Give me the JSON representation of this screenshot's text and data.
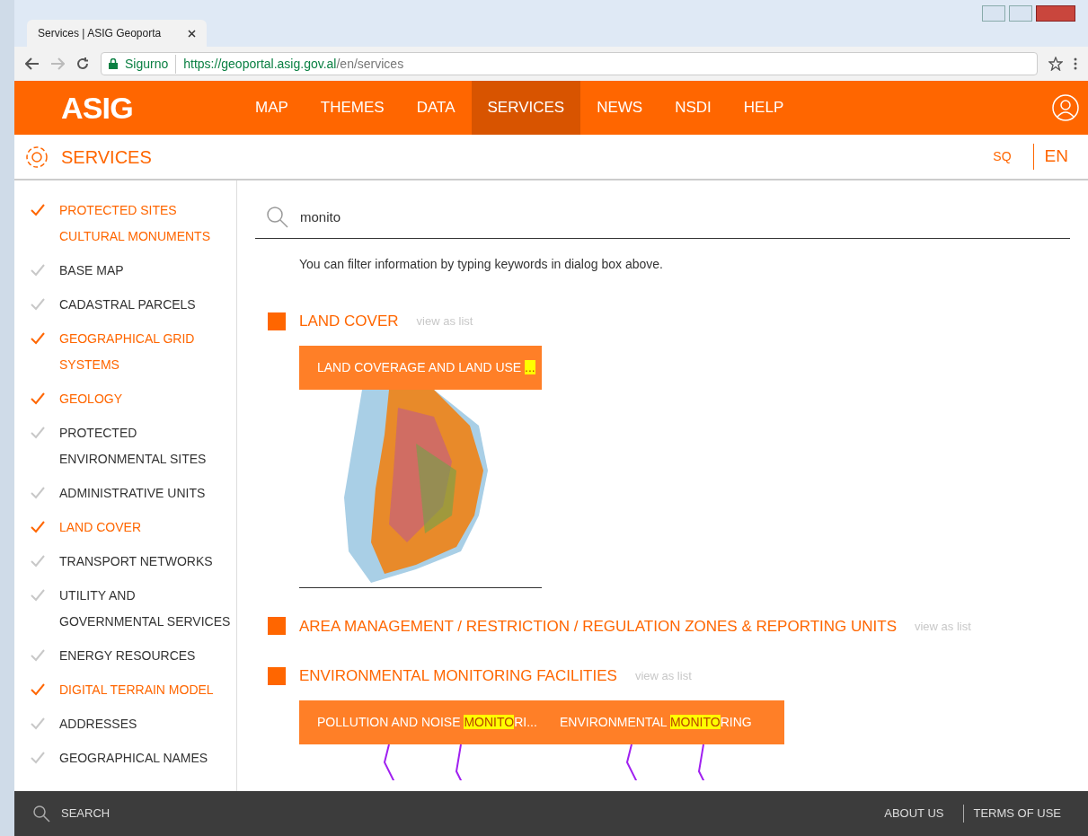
{
  "browser": {
    "tab_title": "Services | ASIG Geoporta",
    "security": "Sigurno",
    "url_host": "https://geoportal.asig.gov.al",
    "url_path": "/en/services"
  },
  "nav": {
    "logo": "ASIG",
    "items": [
      {
        "label": "MAP",
        "selected": false
      },
      {
        "label": "THEMES",
        "selected": false
      },
      {
        "label": "DATA",
        "selected": false
      },
      {
        "label": "SERVICES",
        "selected": true
      },
      {
        "label": "NEWS",
        "selected": false
      },
      {
        "label": "NSDI",
        "selected": false
      },
      {
        "label": "HELP",
        "selected": false
      }
    ]
  },
  "page_header": {
    "title": "SERVICES",
    "languages": [
      {
        "label": "SQ",
        "selected": false
      },
      {
        "label": "EN",
        "selected": true
      }
    ]
  },
  "sidebar": {
    "items": [
      {
        "label": "PROTECTED SITES CULTURAL MONUMENTS",
        "checked": true
      },
      {
        "label": "BASE MAP",
        "checked": false
      },
      {
        "label": "CADASTRAL PARCELS",
        "checked": false
      },
      {
        "label": "GEOGRAPHICAL GRID SYSTEMS",
        "checked": true
      },
      {
        "label": "GEOLOGY",
        "checked": true
      },
      {
        "label": "PROTECTED ENVIRONMENTAL SITES",
        "checked": false
      },
      {
        "label": "ADMINISTRATIVE UNITS",
        "checked": false
      },
      {
        "label": "LAND COVER",
        "checked": true
      },
      {
        "label": "TRANSPORT NETWORKS",
        "checked": false
      },
      {
        "label": "UTILITY AND GOVERNMENTAL SERVICES",
        "checked": false
      },
      {
        "label": "ENERGY RESOURCES",
        "checked": false
      },
      {
        "label": "DIGITAL TERRAIN MODEL",
        "checked": true
      },
      {
        "label": "ADDRESSES",
        "checked": false
      },
      {
        "label": "GEOGRAPHICAL NAMES",
        "checked": false
      }
    ]
  },
  "search": {
    "value": "monito",
    "hint": "You can filter information by typing keywords in dialog box above."
  },
  "sections": [
    {
      "title": "LAND COVER",
      "link": "view as list",
      "cards": [
        {
          "before": "LAND COVERAGE AND LAND USE ",
          "highlight": "...",
          "kind": "landcover"
        }
      ]
    },
    {
      "title": "AREA MANAGEMENT / RESTRICTION / REGULATION ZONES & REPORTING UNITS",
      "link": "view as list"
    },
    {
      "title": "ENVIRONMENTAL MONITORING FACILITIES",
      "link": "view as list",
      "cards": [
        {
          "before": "POLLUTION AND NOISE ",
          "highlight": "MONITO",
          "after": "RI...",
          "kind": "points"
        },
        {
          "before": "ENVIRONMENTAL ",
          "highlight": "MONITO",
          "after": "RING",
          "kind": "points"
        }
      ]
    }
  ],
  "footer": {
    "search": "SEARCH",
    "links": [
      "ABOUT US",
      "TERMS OF USE"
    ]
  }
}
